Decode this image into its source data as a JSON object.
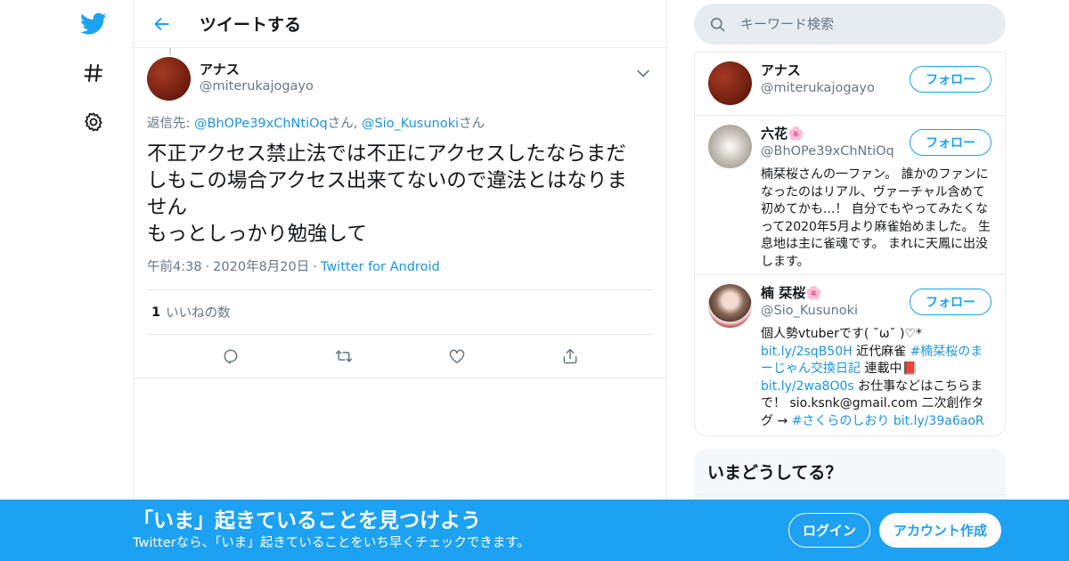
{
  "nav": {
    "icons": [
      "twitter-bird-icon",
      "hashtag-icon",
      "gear-icon"
    ]
  },
  "header": {
    "title": "ツイートする"
  },
  "tweet": {
    "author_name": "アナス",
    "author_handle": "@miterukajogayo",
    "reply_prefix": "返信先: ",
    "reply_to": [
      {
        "handle": "@BhOPe39xChNtiOq",
        "suffix": "さん"
      },
      {
        "handle": "@Sio_Kusunoki",
        "suffix": "さん"
      }
    ],
    "reply_separator": ", ",
    "text": "不正アクセス禁止法では不正にアクセスしたならまだしもこの場合アクセス出来てないので違法とはなりません\nもっとしっかり勉強して",
    "time": "午前4:38",
    "date": "2020年8月20日",
    "source": "Twitter for Android",
    "meta_sep": "·",
    "likes_count": "1",
    "likes_label": "いいねの数",
    "action_icons": [
      "reply-icon",
      "retweet-icon",
      "like-icon",
      "share-icon"
    ]
  },
  "search": {
    "placeholder": "キーワード検索"
  },
  "users": [
    {
      "name": "アナス",
      "handle": "@miterukajogayo",
      "follow_label": "フォロー",
      "bio": ""
    },
    {
      "name": "六花",
      "name_emoji": "🌸",
      "handle": "@BhOPe39xChNtiOq",
      "follow_label": "フォロー",
      "bio": "楠栞桜さんの一ファン。 誰かのファンになったのはリアル、ヴァーチャル含めて初めてかも...！ 自分でもやってみたくなって2020年5月より麻雀始めました。 生息地は主に雀魂です。 まれに天鳳に出没します。"
    },
    {
      "name": "楠 栞桜",
      "name_emoji": "🌸",
      "handle": "@Sio_Kusunoki",
      "follow_label": "フォロー",
      "bio_parts": {
        "p1": "個人勢vtuberです( ˘ω˘ )♡*",
        "l1": "bit.ly/2sqB50H",
        "p2": " 近代麻雀 ",
        "l2": "#楠栞桜のまーじゃん交換日記",
        "p3": " 連載中",
        "book": "📕",
        "l3": "bit.ly/2wa8O0s",
        "p4": " お仕事などはこちらまで！ sio.ksnk@gmail.com 二次創作タグ → ",
        "l4": "#さくらのしおり",
        "p5": " ",
        "l5": "bit.ly/39a6aoR"
      }
    }
  ],
  "trends": {
    "title": "いまどうしてる？"
  },
  "bottom_bar": {
    "title": "「いま」起きていることを見つけよう",
    "subtitle": "Twitterなら、「いま」起きていることをいち早くチェックできます。",
    "login_label": "ログイン",
    "signup_label": "アカウント作成"
  },
  "colors": {
    "brand_blue": "#1da1f2",
    "link_blue": "#1b95e0",
    "secondary_text": "#657786"
  }
}
